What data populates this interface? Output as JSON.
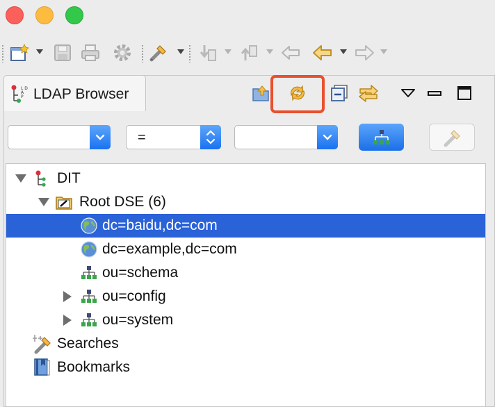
{
  "view": {
    "tab_title": "LDAP Browser"
  },
  "filter": {
    "attribute_value": "",
    "operator_value": "=",
    "value_value": ""
  },
  "tree": {
    "dit_label": "DIT",
    "root_dse_label": "Root DSE (6)",
    "entries": [
      {
        "label": "dc=baidu,dc=com",
        "selected": true
      },
      {
        "label": "dc=example,dc=com",
        "selected": false
      },
      {
        "label": "ou=schema",
        "selected": false
      },
      {
        "label": "ou=config",
        "selected": false
      },
      {
        "label": "ou=system",
        "selected": false
      }
    ],
    "searches_label": "Searches",
    "bookmarks_label": "Bookmarks"
  },
  "colors": {
    "selection": "#2a62d8",
    "highlight": "#e8502f",
    "accent_blue": "#1a72f0"
  }
}
